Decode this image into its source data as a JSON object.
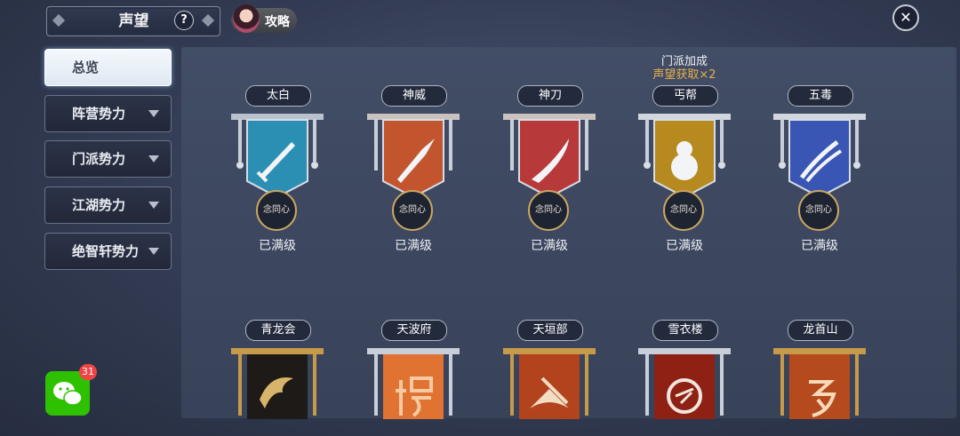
{
  "header": {
    "title": "声望",
    "help_label": "?",
    "guide_label": "攻略",
    "close_label": "✕"
  },
  "sidebar": {
    "items": [
      {
        "label": "总览",
        "active": true,
        "arrow": false
      },
      {
        "label": "阵营势力",
        "arrow": true
      },
      {
        "label": "门派势力",
        "arrow": true
      },
      {
        "label": "江湖势力",
        "arrow": true
      },
      {
        "label": "绝智轩势力",
        "arrow": true
      }
    ]
  },
  "bonus": {
    "line1": "门派加成",
    "line2": "声望获取×2"
  },
  "factions_row1": [
    {
      "name": "太白",
      "medal": "念同心",
      "status": "已满级",
      "color": "#2b8fb3",
      "icon": "sword-icon"
    },
    {
      "name": "神威",
      "medal": "念同心",
      "status": "已满级",
      "color": "#c2552e",
      "icon": "spear-icon"
    },
    {
      "name": "神刀",
      "medal": "念同心",
      "status": "已满级",
      "color": "#b8393a",
      "icon": "blade-icon"
    },
    {
      "name": "丐帮",
      "medal": "念同心",
      "status": "已满级",
      "color": "#b68a1e",
      "icon": "gourd-icon"
    },
    {
      "name": "五毒",
      "medal": "念同心",
      "status": "已满级",
      "color": "#3a56b5",
      "icon": "claw-icon"
    }
  ],
  "factions_row2": [
    {
      "name": "青龙会",
      "color": "#1d1a17",
      "icon": "dragon-icon"
    },
    {
      "name": "天波府",
      "color": "#e07232",
      "icon": "yang-glyph-icon"
    },
    {
      "name": "天垣部",
      "color": "#b2431d",
      "icon": "fan-icon"
    },
    {
      "name": "雪衣楼",
      "color": "#8e2014",
      "icon": "circle-emblem-icon"
    },
    {
      "name": "龙首山",
      "color": "#b54a1c",
      "icon": "script-glyph-icon"
    }
  ],
  "notification": {
    "count": "31"
  }
}
